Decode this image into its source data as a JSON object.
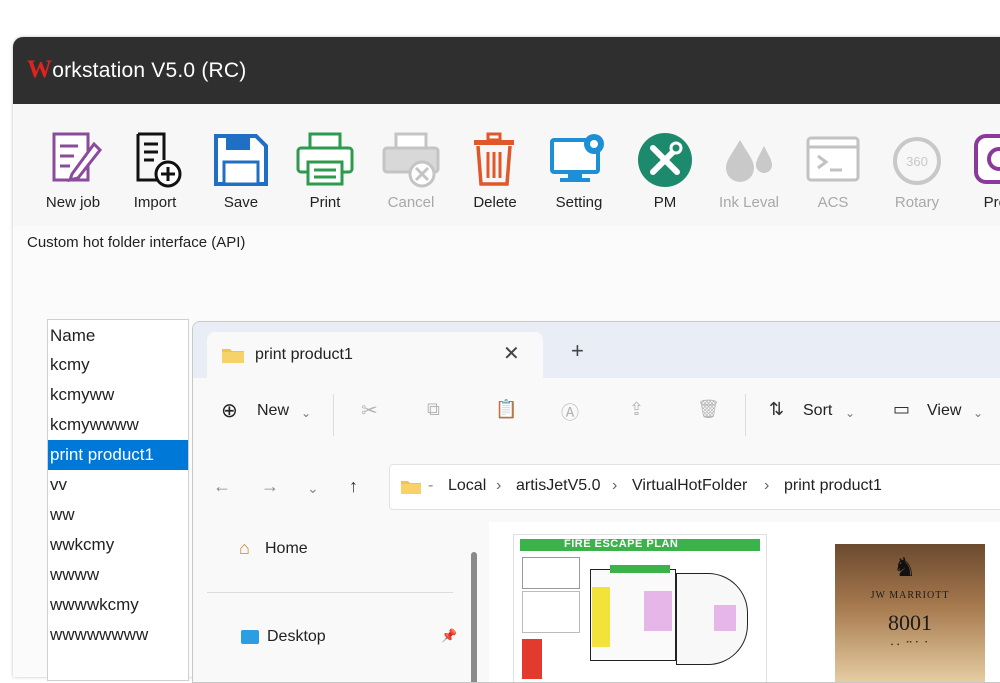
{
  "app": {
    "title_initial": "W",
    "title_rest": "orkstation V5.0 (RC)"
  },
  "toolbar": [
    {
      "label": "New job",
      "icon": "new-job-icon",
      "enabled": true
    },
    {
      "label": "Import",
      "icon": "import-icon",
      "enabled": true
    },
    {
      "label": "Save",
      "icon": "save-icon",
      "enabled": true
    },
    {
      "label": "Print",
      "icon": "printer-icon",
      "enabled": true
    },
    {
      "label": "Cancel",
      "icon": "cancel-print-icon",
      "enabled": false
    },
    {
      "label": "Delete",
      "icon": "trash-icon",
      "enabled": true
    },
    {
      "label": "Setting",
      "icon": "monitor-gear-icon",
      "enabled": true
    },
    {
      "label": "PM",
      "icon": "tools-icon",
      "enabled": true
    },
    {
      "label": "Ink Leval",
      "icon": "ink-drops-icon",
      "enabled": false
    },
    {
      "label": "ACS",
      "icon": "terminal-icon",
      "enabled": false
    },
    {
      "label": "Rotary",
      "icon": "rotary-360-icon",
      "enabled": false
    },
    {
      "label": "Prev",
      "icon": "preview-icon",
      "enabled": true
    }
  ],
  "panel_caption": "Custom hot folder interface (API)",
  "folder_list": {
    "header": "Name",
    "items": [
      "kcmy",
      "kcmyww",
      "kcmywwww",
      "print product1",
      "vv",
      "ww",
      "wwkcmy",
      "wwww",
      "wwwwkcmy",
      "wwwwwwww"
    ],
    "selected": "print product1"
  },
  "explorer": {
    "tab_title": "print product1",
    "tab_close": "✕",
    "new_tab": "+",
    "commands": {
      "new": "New",
      "sort": "Sort",
      "view": "View"
    },
    "breadcrumb": [
      "Local",
      "artisJetV5.0",
      "VirtualHotFolder",
      "print product1"
    ],
    "nav": {
      "home": "Home",
      "desktop": "Desktop"
    },
    "thumbnails": {
      "plan_title": "FIRE ESCAPE PLAN",
      "sign_brand": "JW MARRIOTT",
      "sign_number": "8001"
    }
  },
  "colors": {
    "titlebar": "#2f2f2f",
    "accent_red": "#e1231f",
    "selection": "#0078d7",
    "tab_strip": "#e9eef6"
  }
}
